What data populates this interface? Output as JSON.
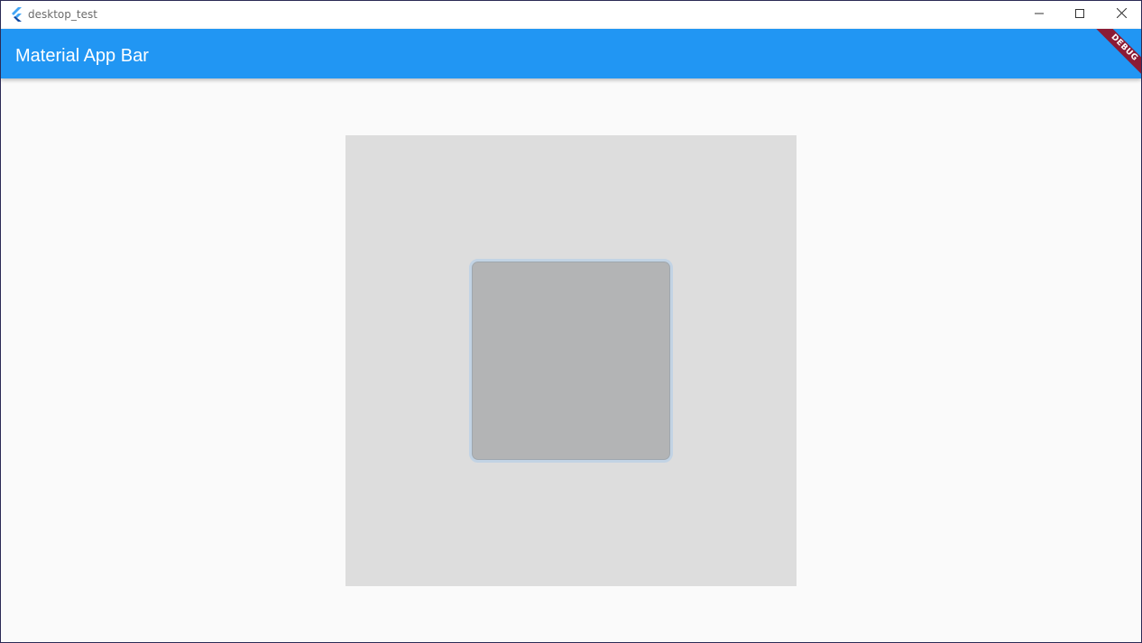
{
  "window": {
    "title": "desktop_test",
    "icon": "flutter-logo-icon",
    "controls": {
      "minimize_icon": "minimize-icon",
      "maximize_icon": "maximize-icon",
      "close_icon": "close-icon"
    }
  },
  "appbar": {
    "title": "Material App Bar",
    "color": "#2196f3"
  },
  "debug_banner": {
    "label": "DEBUG",
    "color": "#8b1b35"
  },
  "content": {
    "outer_square_color": "#dddddd",
    "inner_button_color": "#b3b4b5",
    "inner_button_border_color": "#c2d3e4"
  }
}
